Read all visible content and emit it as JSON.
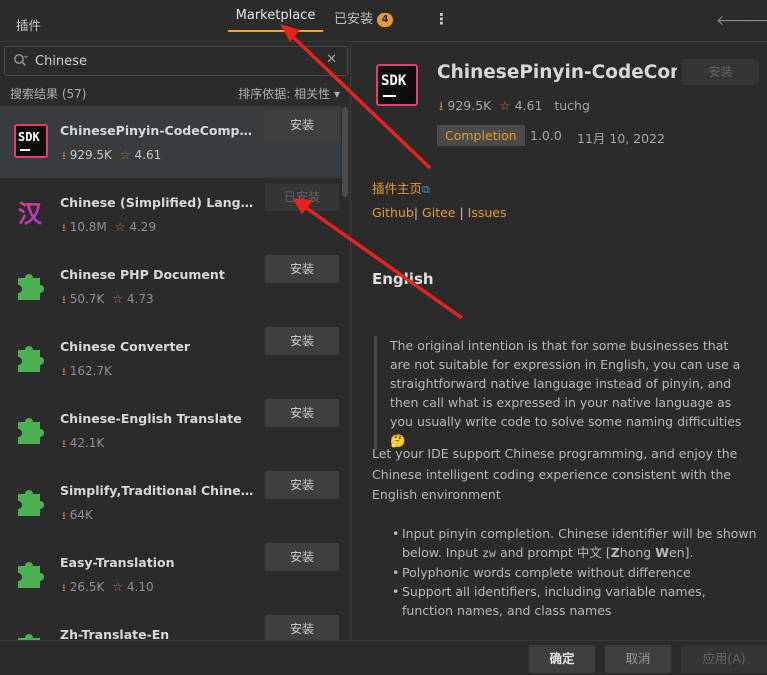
{
  "header": {
    "title": "插件",
    "tabs": [
      {
        "label": "Marketplace",
        "active": true
      },
      {
        "label": "已安装",
        "badge": "4"
      }
    ],
    "more_icon": "kebab-icon",
    "back_icon": "arrow-left-icon",
    "forward_icon": "arrow-right-icon"
  },
  "search": {
    "value": "Chinese",
    "results_label": "搜索结果 (57)",
    "sort_label": "排序依据: 相关性 ▾"
  },
  "plugins": [
    {
      "name": "ChinesePinyin-CodeCompletionHelper",
      "downloads": "929.5K",
      "rating": "4.61",
      "button": "安装",
      "icon": "sdk-icon",
      "selected": true
    },
    {
      "name": "Chinese (Simplified) Language Pack",
      "downloads": "10.8M",
      "rating": "4.29",
      "button": "已安装",
      "icon": "han-character-icon",
      "installed": true
    },
    {
      "name": "Chinese PHP Document",
      "downloads": "50.7K",
      "rating": "4.73",
      "button": "安装",
      "icon": "puzzle-piece-icon"
    },
    {
      "name": "Chinese Converter",
      "downloads": "162.7K",
      "rating": "",
      "button": "安装",
      "icon": "puzzle-piece-icon"
    },
    {
      "name": "Chinese-English Translate",
      "downloads": "42.1K",
      "rating": "",
      "button": "安装",
      "icon": "puzzle-piece-icon"
    },
    {
      "name": "Simplify,Traditional Chinese Converter",
      "downloads": "64K",
      "rating": "",
      "button": "安装",
      "icon": "puzzle-piece-icon"
    },
    {
      "name": "Easy-Translation",
      "downloads": "26.5K",
      "rating": "4.10",
      "button": "安装",
      "icon": "puzzle-piece-icon"
    },
    {
      "name": "Zh-Translate-En",
      "downloads": "",
      "rating": "",
      "button": "安装",
      "icon": "puzzle-piece-icon"
    }
  ],
  "detail": {
    "name": "ChinesePinyin-CodeCompletionHelper",
    "install_label": "安装",
    "downloads": "929.5K",
    "rating": "4.61",
    "author": "tuchg",
    "tag": "Completion",
    "version": "1.0.0",
    "date": "11月 10, 2022",
    "homepage": "插件主页",
    "links": [
      "Github",
      "Gitee",
      "Issues"
    ],
    "heading": "English",
    "quote": "The original intention is that for some businesses that are not suitable for expression in English, you can use a straightforward native language instead of pinyin, and then call what is expressed in your native language as you usually write code to solve some naming difficulties 🤔",
    "paragraph": "Let your IDE support Chinese programming, and enjoy the Chinese intelligent coding experience consistent with the English environment",
    "bullets": [
      "Input pinyin completion. Chinese identifier will be shown below. Input zw and prompt 中文 [Zhong Wen].",
      "Polyphonic words complete without difference",
      "Support all identifiers, including variable names, function names, and class names"
    ]
  },
  "footer": {
    "ok": "确定",
    "cancel": "取消",
    "apply": "应用(A)"
  },
  "colors": {
    "accent": "#e89a2a",
    "annotation": "#e8221c"
  }
}
